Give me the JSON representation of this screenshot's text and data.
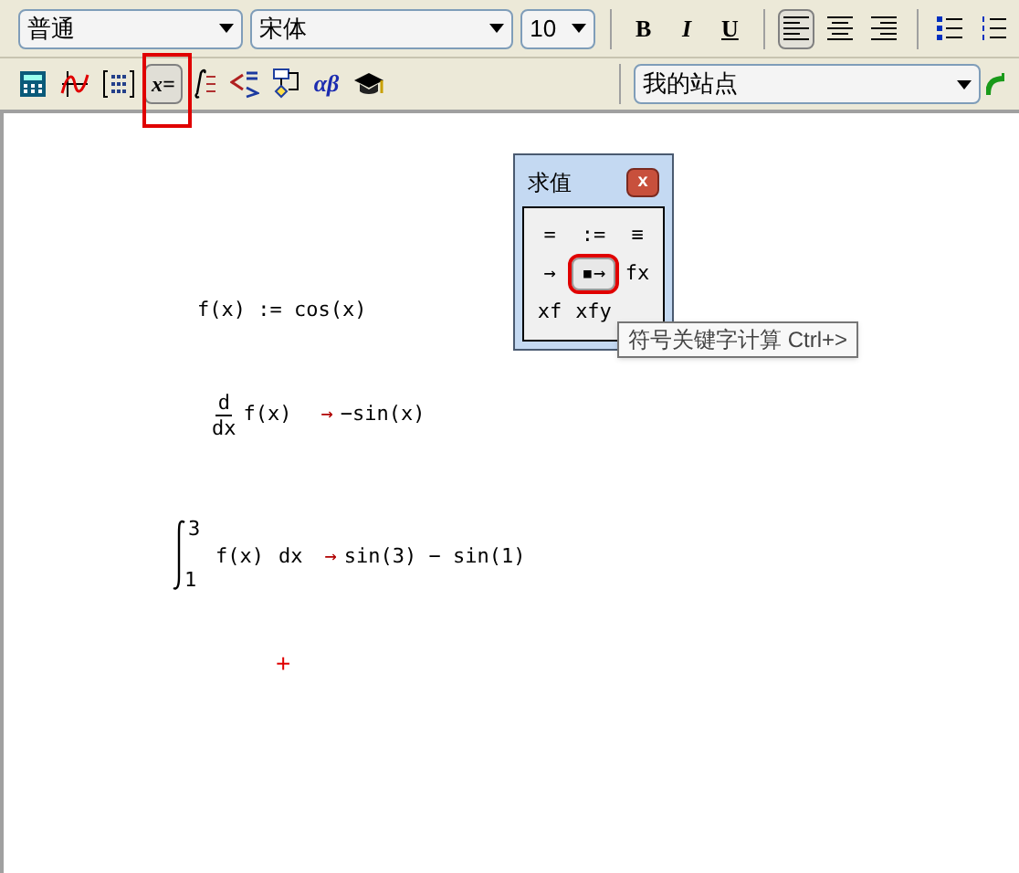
{
  "format_toolbar": {
    "style": "普通",
    "font": "宋体",
    "size": "10",
    "text_buttons": [
      {
        "kind": "bold",
        "label": "B",
        "selected": false
      },
      {
        "kind": "italic",
        "label": "I",
        "selected": false
      },
      {
        "kind": "underline",
        "label": "U",
        "selected": false
      }
    ],
    "align_buttons": [
      {
        "kind": "left",
        "selected": true
      },
      {
        "kind": "center",
        "selected": false
      },
      {
        "kind": "right",
        "selected": false
      }
    ],
    "list_buttons": [
      {
        "kind": "bullets"
      },
      {
        "kind": "numbers"
      }
    ]
  },
  "math_toolbar": [
    {
      "kind": "calculator",
      "selected": false
    },
    {
      "kind": "graph",
      "selected": false
    },
    {
      "kind": "matrix",
      "selected": false
    },
    {
      "kind": "evaluation",
      "label": "x=",
      "selected": true
    },
    {
      "kind": "calculus",
      "selected": false
    },
    {
      "kind": "boolean",
      "selected": false
    },
    {
      "kind": "programming",
      "selected": false
    },
    {
      "kind": "greek",
      "label": "αβ",
      "selected": false
    },
    {
      "kind": "symbolic",
      "selected": false
    }
  ],
  "resources": {
    "value": "我的站点"
  },
  "palette": {
    "title": "求值",
    "close": "x",
    "buttons": [
      {
        "label": "=",
        "selected": false
      },
      {
        "label": ":=",
        "selected": false
      },
      {
        "label": "≡",
        "selected": false
      },
      {
        "label": "→",
        "selected": false
      },
      {
        "label": "▪→",
        "selected": true
      },
      {
        "label": "fx",
        "selected": false
      },
      {
        "label": "xf",
        "selected": false
      },
      {
        "label": "xfy",
        "selected": false
      }
    ]
  },
  "tooltip": "符号关键字计算 Ctrl+>",
  "worksheet": [
    {
      "kind": "definition",
      "text": "f(x) := cos(x)"
    },
    {
      "kind": "derivative",
      "numerator": "d",
      "denominator": "dx",
      "expression": "f(x)",
      "arrow": "→",
      "result": "−sin(x)"
    },
    {
      "kind": "integral",
      "upper": "3",
      "lower": "1",
      "integrand": "f(x)",
      "differential": "dx",
      "arrow": "→",
      "result": "sin(3) − sin(1)"
    },
    {
      "kind": "cursor",
      "text": "+"
    }
  ]
}
